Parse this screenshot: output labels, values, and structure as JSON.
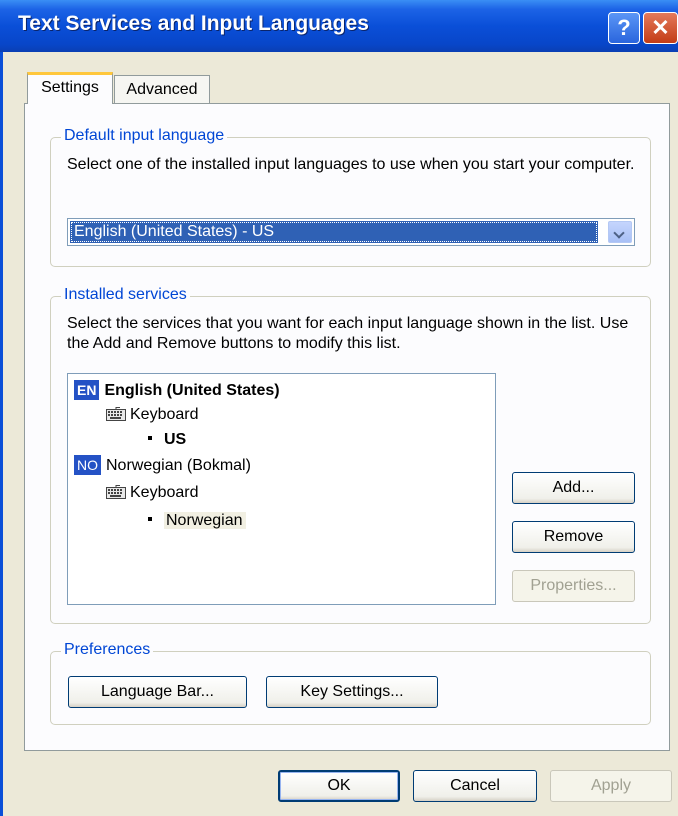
{
  "window": {
    "title": "Text Services and Input Languages",
    "help_glyph": "?",
    "close_glyph": "✕"
  },
  "tabs": [
    {
      "label": "Settings",
      "selected": true
    },
    {
      "label": "Advanced",
      "selected": false
    }
  ],
  "default_input": {
    "legend": "Default input language",
    "description": "Select one of the installed input languages to use when you start your computer.",
    "selected_value": "English (United States) - US"
  },
  "installed_services": {
    "legend": "Installed services",
    "description": "Select the services that you want for each input language shown in the list. Use the Add and Remove buttons to modify this list.",
    "languages": [
      {
        "code": "EN",
        "name": "English (United States)",
        "service": "Keyboard",
        "layout": "US"
      },
      {
        "code": "NO",
        "name": "Norwegian (Bokmal)",
        "service": "Keyboard",
        "layout": "Norwegian"
      }
    ],
    "buttons": {
      "add": "Add...",
      "remove": "Remove",
      "properties": "Properties..."
    }
  },
  "preferences": {
    "legend": "Preferences",
    "language_bar": "Language Bar...",
    "key_settings": "Key Settings..."
  },
  "dialog_buttons": {
    "ok": "OK",
    "cancel": "Cancel",
    "apply": "Apply"
  },
  "colors": {
    "title_bar": "#0a4fd8",
    "group_legend": "#0046d5",
    "selection": "#2f61b5",
    "tab_highlight": "#ffc73c"
  }
}
